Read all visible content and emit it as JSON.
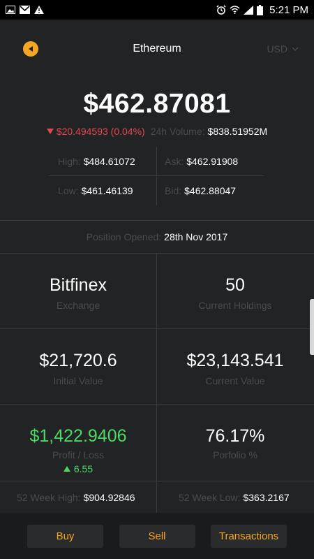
{
  "status_bar": {
    "time": "5:21 PM",
    "left_icons": [
      "gallery-icon",
      "gmail-icon",
      "warning-icon"
    ],
    "right_icons": [
      "alarm-icon",
      "wifi-icon",
      "signal-icon",
      "battery-icon"
    ]
  },
  "header": {
    "title": "Ethereum",
    "currency": "USD"
  },
  "price": {
    "value": "$462.87081",
    "change": "$20.494593 (0.04%)",
    "volume_label": "24h Volume:",
    "volume_value": "$838.51952M"
  },
  "quotes": {
    "high_label": "High:",
    "high_value": "$484.61072",
    "ask_label": "Ask:",
    "ask_value": "$462.91908",
    "low_label": "Low:",
    "low_value": "$461.46139",
    "bid_label": "Bid:",
    "bid_value": "$462.88047"
  },
  "position": {
    "label": "Position Opened:",
    "date": "28th Nov 2017"
  },
  "stats": {
    "exchange_value": "Bitfinex",
    "exchange_label": "Exchange",
    "holdings_value": "50",
    "holdings_label": "Current Holdings",
    "initial_value": "$21,720.6",
    "initial_label": "Initial Value",
    "current_value": "$23,143.541",
    "current_label": "Current Value",
    "profit_value": "$1,422.9406",
    "profit_label": "Profit / Loss",
    "profit_delta": "6.55",
    "portfolio_value": "76.17%",
    "portfolio_label": "Porfolio %"
  },
  "week52": {
    "high_label": "52 Week High:",
    "high_value": "$904.92846",
    "low_label": "52 Week Low:",
    "low_value": "$363.2167"
  },
  "actions": {
    "buy": "Buy",
    "sell": "Sell",
    "transactions": "Transactions"
  },
  "colors": {
    "accent": "#f5a623",
    "negative": "#e5484d",
    "positive": "#4cd964",
    "background": "#222324",
    "muted": "#4a4b4d"
  }
}
